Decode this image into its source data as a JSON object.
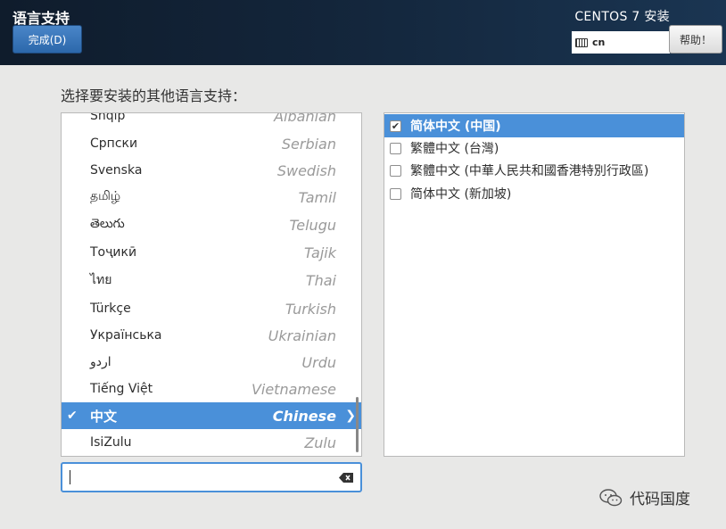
{
  "header": {
    "title": "语言支持",
    "done_label": "完成(D)",
    "product": "CENTOS 7 安装",
    "keyboard_layout": "cn",
    "help_label": "帮助！"
  },
  "prompt": "选择要安装的其他语言支持：",
  "languages": [
    {
      "native": "Shqip",
      "english": "Albanian"
    },
    {
      "native": "Српски",
      "english": "Serbian"
    },
    {
      "native": "Svenska",
      "english": "Swedish"
    },
    {
      "native": "தமிழ்",
      "english": "Tamil"
    },
    {
      "native": "తెలుగు",
      "english": "Telugu"
    },
    {
      "native": "Тоҷикӣ",
      "english": "Tajik"
    },
    {
      "native": "ไทย",
      "english": "Thai"
    },
    {
      "native": "Türkçe",
      "english": "Turkish"
    },
    {
      "native": "Українська",
      "english": "Ukrainian"
    },
    {
      "native": "اردو",
      "english": "Urdu"
    },
    {
      "native": "Tiếng Việt",
      "english": "Vietnamese"
    },
    {
      "native": "中文",
      "english": "Chinese",
      "selected": true
    },
    {
      "native": "IsiZulu",
      "english": "Zulu"
    }
  ],
  "search": {
    "value": ""
  },
  "locales": [
    {
      "label": "简体中文 (中国)",
      "checked": true,
      "selected": true
    },
    {
      "label": "繁體中文 (台灣)",
      "checked": false
    },
    {
      "label": "繁體中文 (中華人民共和國香港特別行政區)",
      "checked": false
    },
    {
      "label": "简体中文 (新加坡)",
      "checked": false
    }
  ],
  "watermark": "代码国度",
  "colors": {
    "accent": "#4a90d9",
    "header_dark": "#0f1c2c",
    "background": "#e8e8e7"
  },
  "icons": {
    "keyboard": "keyboard-icon",
    "clear": "clear-text-icon",
    "check": "check-icon",
    "arrow": "chevron-right-icon"
  }
}
